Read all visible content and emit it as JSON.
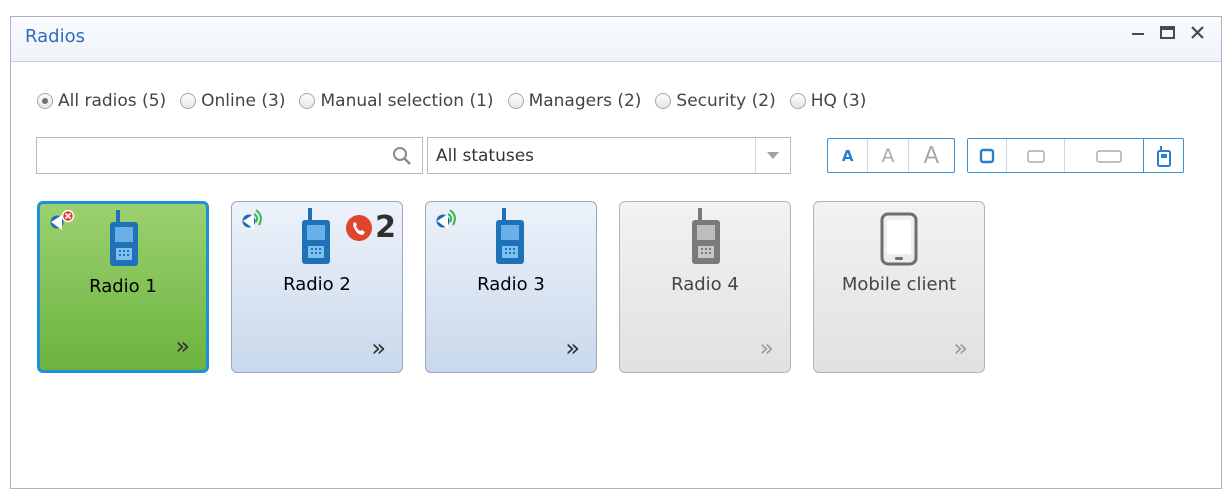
{
  "window": {
    "title": "Radios"
  },
  "filters": [
    {
      "label": "All radios (5)",
      "checked": true
    },
    {
      "label": "Online (3)",
      "checked": false
    },
    {
      "label": "Manual selection (1)",
      "checked": false
    },
    {
      "label": "Managers (2)",
      "checked": false
    },
    {
      "label": "Security (2)",
      "checked": false
    },
    {
      "label": "HQ (3)",
      "checked": false
    }
  ],
  "search": {
    "value": "",
    "placeholder": ""
  },
  "status_filter": {
    "selected": "All statuses"
  },
  "font_size_buttons": [
    "A",
    "A",
    "A"
  ],
  "tiles": [
    {
      "label": "Radio 1",
      "state": "selected",
      "call_count": ""
    },
    {
      "label": "Radio 2",
      "state": "online",
      "call_count": "2"
    },
    {
      "label": "Radio 3",
      "state": "online",
      "call_count": ""
    },
    {
      "label": "Radio 4",
      "state": "offline",
      "call_count": ""
    },
    {
      "label": "Mobile client",
      "state": "offline",
      "call_count": ""
    }
  ],
  "icons": {
    "minimize": "minimize-icon",
    "maximize": "maximize-icon",
    "close": "close-icon",
    "search": "search-icon",
    "chevron": "double-chevron-right-icon"
  },
  "colors": {
    "accent": "#2a7fd0",
    "selected_tile": "#6cb33f",
    "call_badge": "#e0442c"
  }
}
